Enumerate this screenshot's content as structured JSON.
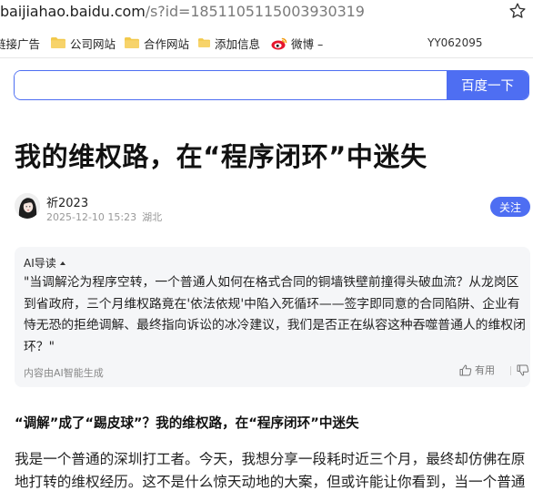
{
  "browser": {
    "url_host": "baijiahao.baidu.com",
    "url_path": "/s?id=1851105115003930319"
  },
  "bookmarks": {
    "items": [
      {
        "label": "链接广告",
        "icon": "folder-icon"
      },
      {
        "label": "公司网站",
        "icon": "folder-icon"
      },
      {
        "label": "合作网站",
        "icon": "folder-icon"
      },
      {
        "label": "添加信息",
        "icon": "folder-icon"
      },
      {
        "label": "微博 –",
        "icon": "weibo-icon"
      }
    ],
    "user": "YY062095"
  },
  "search": {
    "value": "",
    "button_label": "百度一下"
  },
  "article": {
    "title": "我的维权路，在“程序闭环”中迷失",
    "author": "祈2023",
    "date": "2025-12-10 15:23",
    "location": "湖北",
    "follow_label": "关注"
  },
  "ai_summary": {
    "heading": "AI导读",
    "text": "\"当调解沦为程序空转，一个普通人如何在格式合同的铜墙铁壁前撞得头破血流？从龙岗区到省政府，三个月维权路竟在'依法依规'中陷入死循环——签字即同意的合同陷阱、企业有恃无恐的拒绝调解、最终指向诉讼的冰冷建议，我们是否正在纵容这种吞噬普通人的维权闭环？\"",
    "footer": "内容由AI智能生成",
    "useful_label": "有用"
  },
  "body": {
    "section_heading": "“调解”成了“踢皮球”？我的维权路，在“程序闭环”中迷失",
    "paragraph": "我是一个普通的深圳打工者。今天，我想分享一段耗时近三个月，最终却仿佛在原地打转的维权经历。这不是什么惊天动地的大案，但或许能让你看到，当一个普通"
  },
  "colors": {
    "accent": "#4e6ef2",
    "folder": "#f2c94c",
    "weibo": "#e6162d"
  }
}
